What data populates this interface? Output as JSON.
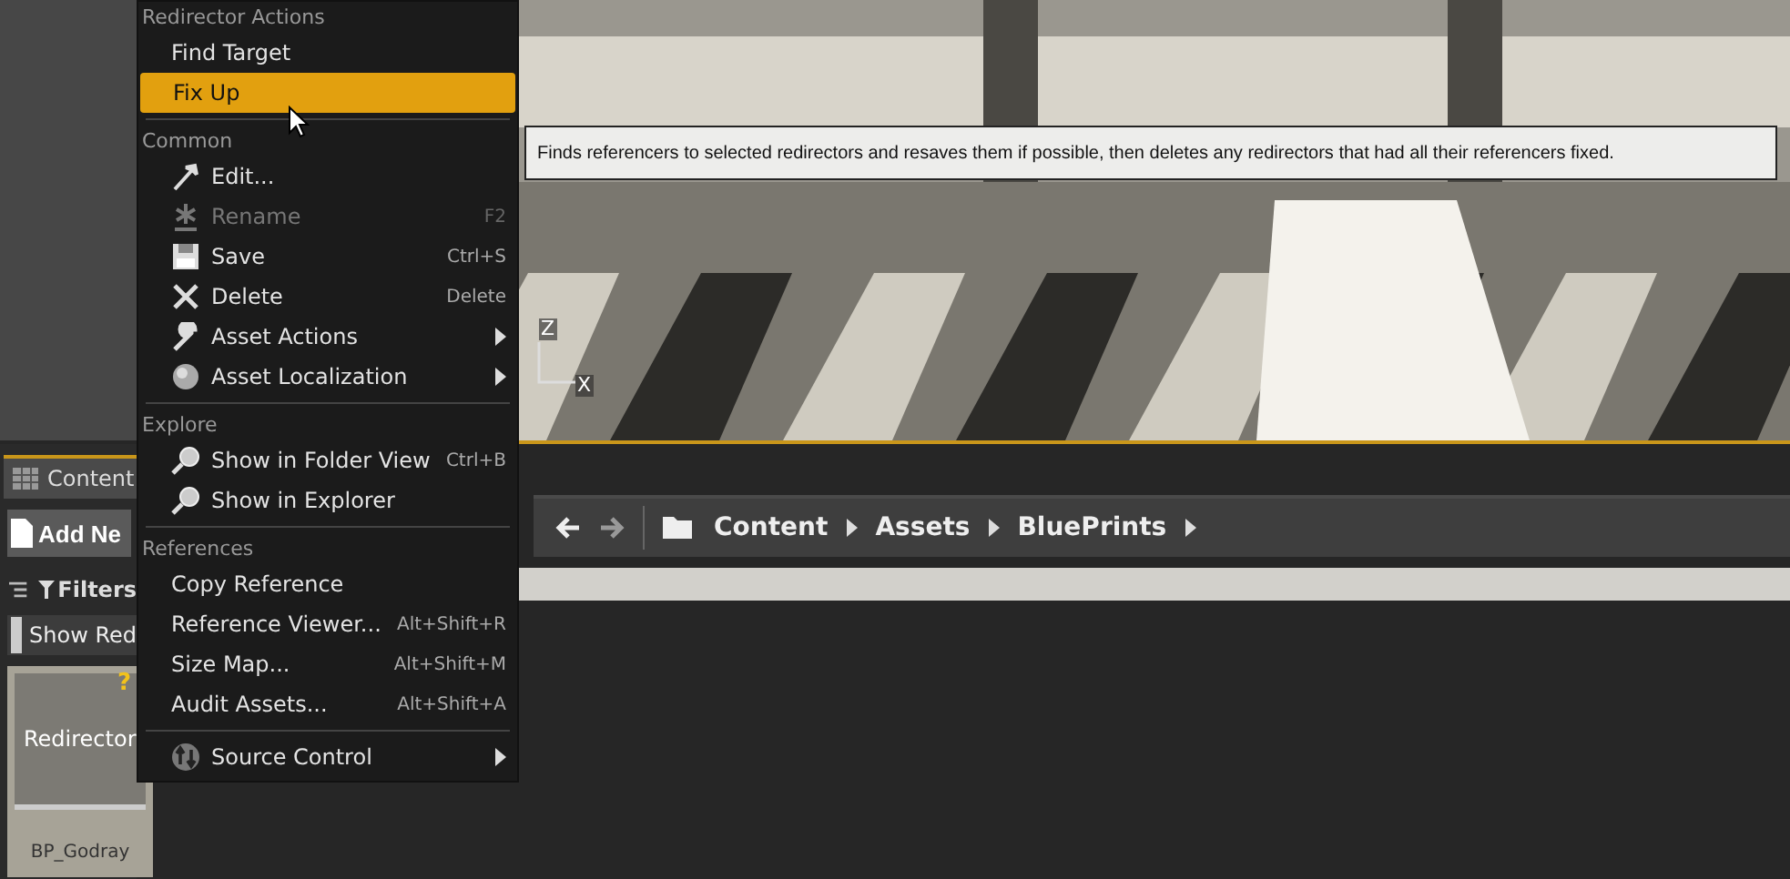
{
  "left_panel": {
    "tab": "Content",
    "add_button": "Add Ne",
    "filters": "Filters",
    "show_toggle": "Show Red",
    "asset_tile": {
      "badge": "?",
      "type_label": "Redirector",
      "name": "BP_Godray"
    }
  },
  "viewport": {
    "kind": "picture",
    "axis_labels": [
      "Z",
      "X"
    ]
  },
  "tooltip": "Finds referencers to selected redirectors and resaves them if possible, then deletes any redirectors that had all their referencers fixed.",
  "breadcrumbs": [
    "Content",
    "Assets",
    "BluePrints"
  ],
  "menu": {
    "sections": [
      {
        "heading": "Redirector Actions",
        "items": [
          {
            "label": "Find Target",
            "selected": false,
            "disabled": false,
            "has_submenu": false
          },
          {
            "label": "Fix Up",
            "selected": true,
            "disabled": false,
            "has_submenu": false
          }
        ]
      },
      {
        "heading": "Common",
        "items": [
          {
            "label": "Edit...",
            "selected": false,
            "disabled": false,
            "has_submenu": false
          },
          {
            "label": "Rename",
            "shortcut": "F2",
            "selected": false,
            "disabled": true,
            "has_submenu": false
          },
          {
            "label": "Save",
            "shortcut": "Ctrl+S",
            "selected": false,
            "disabled": false,
            "has_submenu": false
          },
          {
            "label": "Delete",
            "shortcut": "Delete",
            "selected": false,
            "disabled": false,
            "has_submenu": false
          },
          {
            "label": "Asset Actions",
            "selected": false,
            "disabled": false,
            "has_submenu": true
          },
          {
            "label": "Asset Localization",
            "selected": false,
            "disabled": false,
            "has_submenu": true
          }
        ]
      },
      {
        "heading": "Explore",
        "items": [
          {
            "label": "Show in Folder View",
            "shortcut": "Ctrl+B",
            "selected": false,
            "disabled": false,
            "has_submenu": false
          },
          {
            "label": "Show in Explorer",
            "selected": false,
            "disabled": false,
            "has_submenu": false
          }
        ]
      },
      {
        "heading": "References",
        "items": [
          {
            "label": "Copy Reference",
            "selected": false,
            "disabled": false,
            "has_submenu": false
          },
          {
            "label": "Reference Viewer...",
            "shortcut": "Alt+Shift+R",
            "selected": false,
            "disabled": false,
            "has_submenu": false
          },
          {
            "label": "Size Map...",
            "shortcut": "Alt+Shift+M",
            "selected": false,
            "disabled": false,
            "has_submenu": false
          },
          {
            "label": "Audit Assets...",
            "shortcut": "Alt+Shift+A",
            "selected": false,
            "disabled": false,
            "has_submenu": false
          }
        ]
      },
      {
        "items": [
          {
            "label": "Source Control",
            "selected": false,
            "disabled": false,
            "has_submenu": true
          }
        ]
      }
    ]
  }
}
